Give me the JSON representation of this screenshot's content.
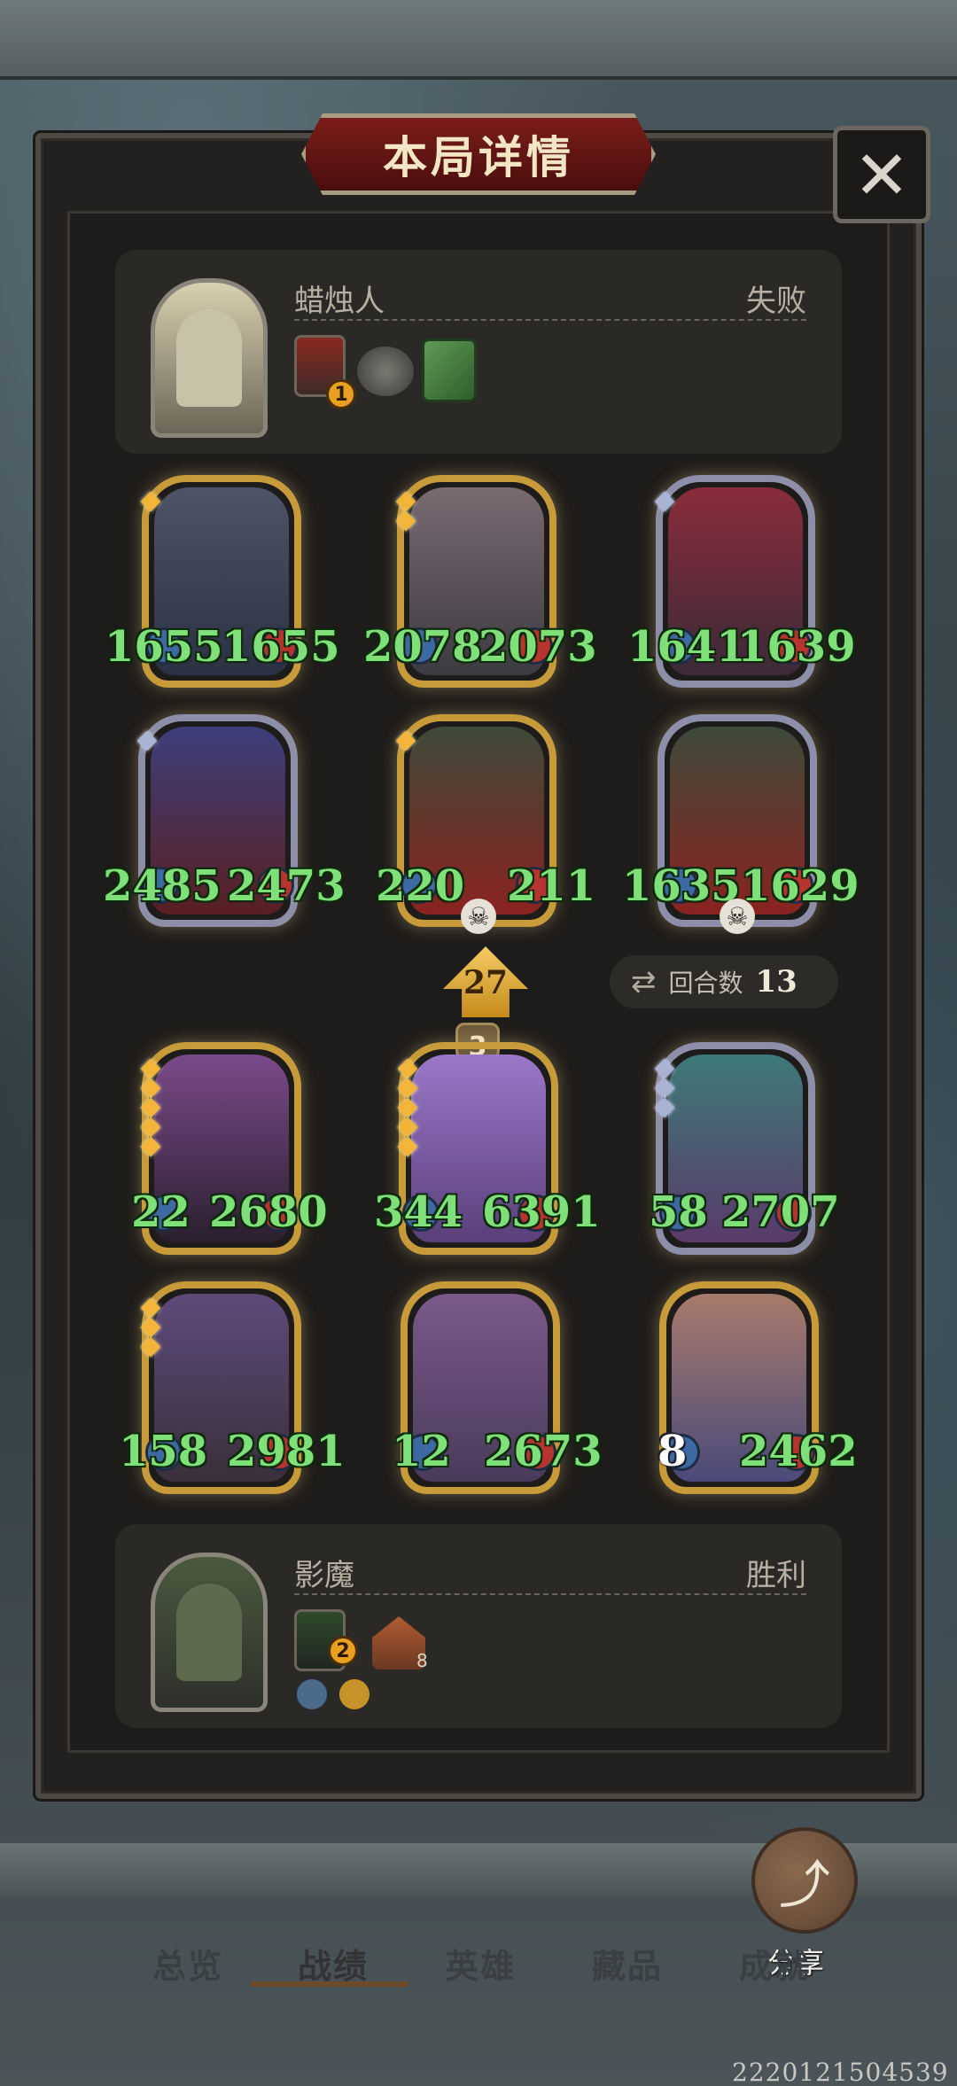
{
  "title": "本局详情",
  "close_label": "✕",
  "player_top": {
    "name": "蜡烛人",
    "result": "失败",
    "items": [
      {
        "icon": "flame-shrine-icon",
        "badge": "1"
      },
      {
        "icon": "pocket-watch-icon"
      },
      {
        "icon": "green-book-icon"
      }
    ]
  },
  "player_bottom": {
    "name": "影魔",
    "result": "胜利",
    "items": [
      {
        "icon": "shadow-shrine-icon",
        "badge": "2"
      },
      {
        "icon": "house-icon",
        "count": "8"
      }
    ],
    "skills": [
      {
        "icon": "crossed-swords-icon"
      },
      {
        "icon": "gold-rune-icon"
      }
    ]
  },
  "enemy_board": [
    {
      "atk": "1655",
      "hp": "1655",
      "frame": "gold",
      "stars": 1
    },
    {
      "atk": "2078",
      "hp": "2073",
      "frame": "gold",
      "stars": 2
    },
    {
      "atk": "1641",
      "hp": "1639",
      "frame": "silver",
      "stars": 1
    },
    {
      "atk": "2485",
      "hp": "2473",
      "frame": "silver",
      "stars": 1
    },
    {
      "atk": "220",
      "hp": "211",
      "frame": "gold",
      "stars": 1,
      "dead": true
    },
    {
      "atk": "1635",
      "hp": "1629",
      "frame": "silver",
      "stars": 0,
      "dead": true
    }
  ],
  "arrow_value": "27",
  "level": "3",
  "round": {
    "label": "回合数",
    "value": "13"
  },
  "player_board": [
    {
      "atk": "22",
      "hp": "2680",
      "frame": "gold",
      "stars": 5
    },
    {
      "atk": "344",
      "hp": "6391",
      "frame": "gold",
      "stars": 5
    },
    {
      "atk": "58",
      "hp": "2707",
      "frame": "silver",
      "stars": 3
    },
    {
      "atk": "158",
      "hp": "2981",
      "frame": "gold",
      "stars": 3
    },
    {
      "atk": "12",
      "hp": "2673",
      "frame": "gold",
      "stars": 0
    },
    {
      "atk": "8",
      "hp": "2462",
      "frame": "gold",
      "stars": 0
    }
  ],
  "nav": [
    "总览",
    "战绩",
    "英雄",
    "藏品",
    "成就"
  ],
  "share_label": "分享",
  "footer_id": "2220121504539",
  "colors": {
    "stat_green": "#7fe07a",
    "gold_frame": "#c79a3a",
    "silver_frame": "#8d8ea8"
  }
}
